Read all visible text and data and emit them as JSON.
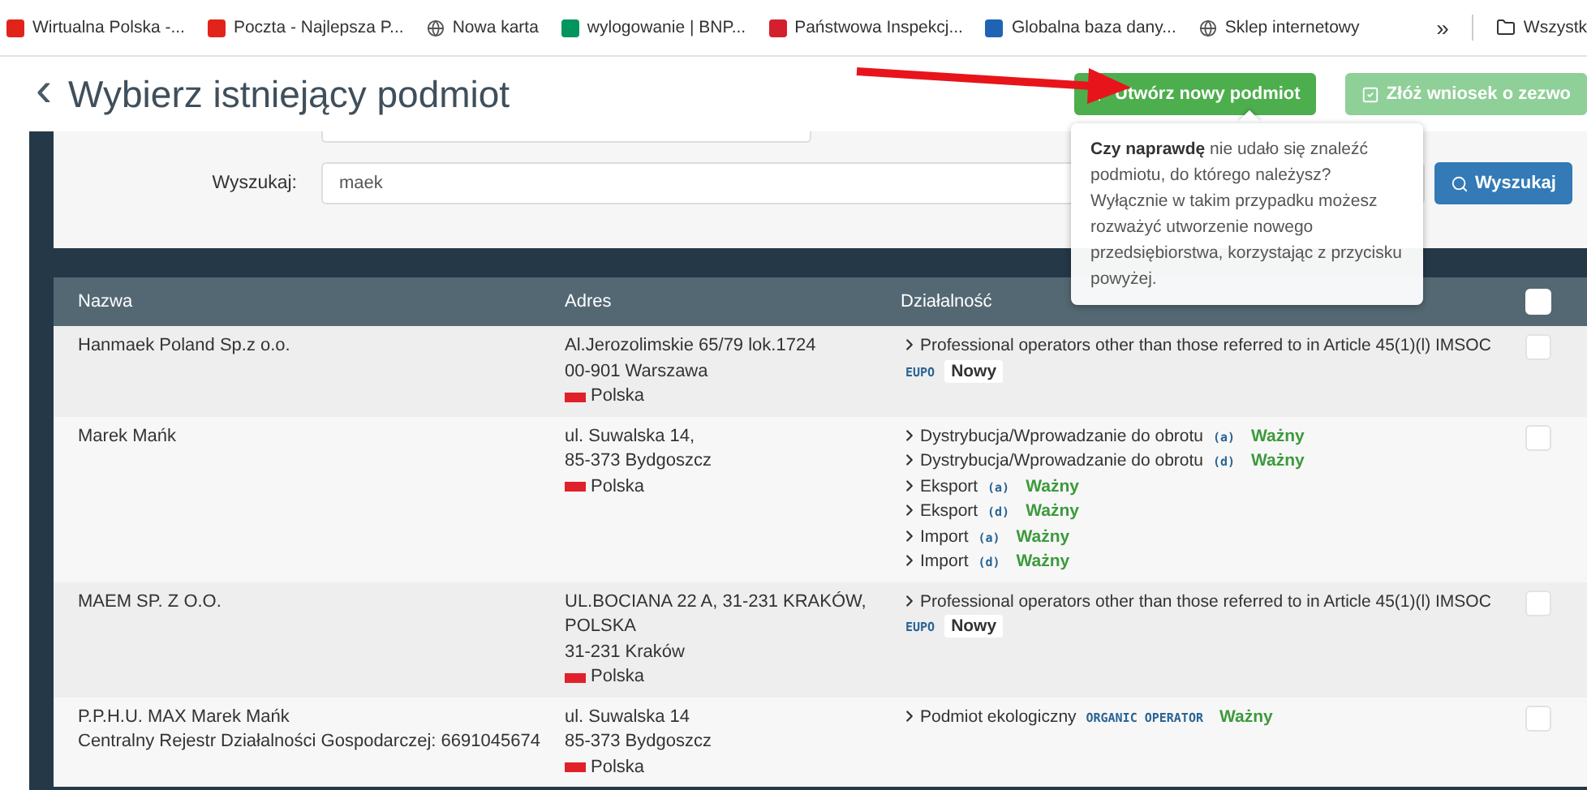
{
  "bookmarks": [
    {
      "label": "Wirtualna Polska -...",
      "kind": "logo",
      "color": "#e2231a"
    },
    {
      "label": "Poczta - Najlepsza P...",
      "kind": "logo",
      "color": "#e2231a"
    },
    {
      "label": "Nowa karta",
      "kind": "globe"
    },
    {
      "label": "wylogowanie | BNP...",
      "kind": "logo",
      "color": "#00965e"
    },
    {
      "label": "Państwowa Inspekcj...",
      "kind": "logo",
      "color": "#d4202c"
    },
    {
      "label": "Globalna baza dany...",
      "kind": "logo",
      "color": "#1f63b5"
    },
    {
      "label": "Sklep internetowy",
      "kind": "globe"
    }
  ],
  "bookmarks_more": "»",
  "bookmarks_folder": "Wszystk",
  "page": {
    "back": "‹",
    "title": "Wybierz istniejący podmiot"
  },
  "actions": [
    {
      "label": "Utwórz nowy podmiot",
      "kind": "create"
    },
    {
      "label": "Złóż wniosek o zezwo",
      "kind": "apply"
    }
  ],
  "search": {
    "label": "Wyszukaj:",
    "value": "maek",
    "button": "Wyszukaj"
  },
  "tooltip": "**Czy naprawdę** nie udało się znaleźć podmiotu, do którego należysz? Wyłącznie w takim przypadku możesz rozważyć utworzenie nowego przedsiębiorstwa, korzystając z przycisku powyżej.",
  "table": {
    "columns": [
      "Nazwa",
      "Adres",
      "Działalność"
    ],
    "all_checked": false,
    "rows": [
      {
        "name": [
          "Hanmaek Poland Sp.z o.o."
        ],
        "address": [
          "Al.Jerozolimskie 65/79 lok.1724",
          "00-901 Warszawa"
        ],
        "country": "Polska",
        "checked": false,
        "activities": [
          {
            "text": "Professional operators other than those referred to in Article 45(1)(l) IMSOC",
            "code": "EUPO",
            "status": {
              "label": "Nowy",
              "kind": "new"
            }
          }
        ]
      },
      {
        "name": [
          "Marek Mańk"
        ],
        "address": [
          "ul. Suwalska 14,",
          "85-373 Bydgoszcz"
        ],
        "country": "Polska",
        "checked": false,
        "activities": [
          {
            "text": "Dystrybucja/Wprowadzanie do obrotu",
            "code": "(a)",
            "status": {
              "label": "Ważny",
              "kind": "valid"
            }
          },
          {
            "text": "Dystrybucja/Wprowadzanie do obrotu",
            "code": "(d)",
            "status": {
              "label": "Ważny",
              "kind": "valid"
            }
          },
          {
            "text": "Eksport",
            "code": "(a)",
            "status": {
              "label": "Ważny",
              "kind": "valid"
            }
          },
          {
            "text": "Eksport",
            "code": "(d)",
            "status": {
              "label": "Ważny",
              "kind": "valid"
            }
          },
          {
            "text": "Import",
            "code": "(a)",
            "status": {
              "label": "Ważny",
              "kind": "valid"
            }
          },
          {
            "text": "Import",
            "code": "(d)",
            "status": {
              "label": "Ważny",
              "kind": "valid"
            }
          }
        ]
      },
      {
        "name": [
          "MAEM SP. Z O.O."
        ],
        "address": [
          "UL.BOCIANA 22 A, 31-231 KRAKÓW, POLSKA",
          "31-231 Kraków"
        ],
        "country": "Polska",
        "checked": false,
        "activities": [
          {
            "text": "Professional operators other than those referred to in Article 45(1)(l) IMSOC",
            "code": "EUPO",
            "status": {
              "label": "Nowy",
              "kind": "new"
            }
          }
        ]
      },
      {
        "name": [
          "P.P.H.U. MAX Marek Mańk",
          "Centralny Rejestr Działalności Gospodarczej: 6691045674"
        ],
        "address": [
          "ul. Suwalska 14",
          "85-373 Bydgoszcz"
        ],
        "country": "Polska",
        "checked": false,
        "activities": [
          {
            "text": "Podmiot ekologiczny",
            "code": "ORGANIC OPERATOR",
            "status": {
              "label": "Ważny",
              "kind": "valid"
            }
          }
        ]
      }
    ]
  }
}
